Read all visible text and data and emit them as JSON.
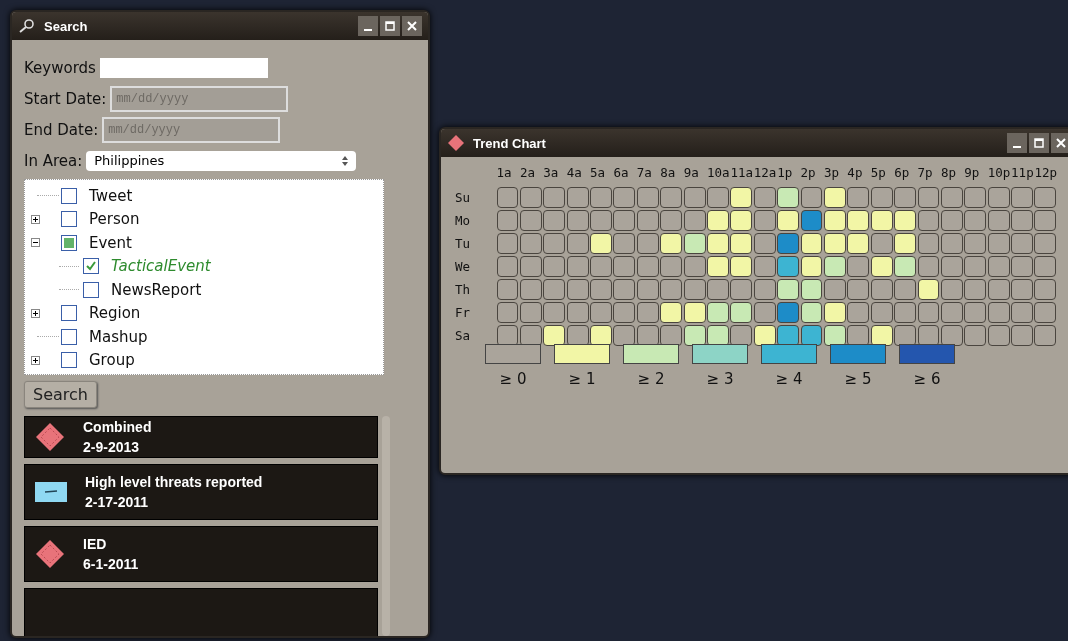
{
  "search_window": {
    "title": "Search",
    "keywords": {
      "label": "Keywords"
    },
    "start_date": {
      "label": "Start Date:",
      "placeholder": "mm/dd/yyyy"
    },
    "end_date": {
      "label": "End Date:",
      "placeholder": "mm/dd/yyyy"
    },
    "area": {
      "label": "In Area:",
      "value": "Philippines"
    },
    "tree": [
      {
        "label": "Tweet",
        "checked": false,
        "indeterminate": false,
        "selected": false
      },
      {
        "label": "Person",
        "checked": false,
        "indeterminate": false,
        "selected": false,
        "expanded": false
      },
      {
        "label": "Event",
        "checked": false,
        "indeterminate": true,
        "selected": false,
        "expanded": true,
        "children": [
          {
            "label": "TacticalEvent",
            "checked": true,
            "selected": true
          },
          {
            "label": "NewsReport",
            "checked": false,
            "indeterminate": false,
            "selected": false
          }
        ]
      },
      {
        "label": "Region",
        "checked": false,
        "indeterminate": false,
        "selected": false,
        "expanded": false
      },
      {
        "label": "Mashup",
        "checked": false,
        "indeterminate": false,
        "selected": false
      },
      {
        "label": "Group",
        "checked": false,
        "indeterminate": false,
        "selected": false,
        "expanded": false
      }
    ],
    "search_button": "Search",
    "results": [
      {
        "kind": "diamond",
        "title": "Combined",
        "date": "2-9-2013"
      },
      {
        "kind": "flag",
        "title": "High level threats reported",
        "date": "2-17-2011"
      },
      {
        "kind": "diamond",
        "title": "IED",
        "date": "6-1-2011"
      },
      {
        "kind": "empty"
      }
    ]
  },
  "trend_window": {
    "title": "Trend Chart",
    "hours": [
      "1a",
      "2a",
      "3a",
      "4a",
      "5a",
      "6a",
      "7a",
      "8a",
      "9a",
      "10a",
      "11a",
      "12a",
      "1p",
      "2p",
      "3p",
      "4p",
      "5p",
      "6p",
      "7p",
      "8p",
      "9p",
      "10p",
      "11p",
      "12p"
    ],
    "days": [
      {
        "label": "Su",
        "cells": [
          {
            "color": "#aaa49b"
          },
          {
            "color": "#aaa49b"
          },
          {
            "color": "#aaa49b"
          },
          {
            "color": "#aaa49b"
          },
          {
            "color": "#aaa49b"
          },
          {
            "color": "#aaa49b"
          },
          {
            "color": "#aaa49b"
          },
          {
            "color": "#aaa49b"
          },
          {
            "color": "#aaa49b"
          },
          {
            "color": "#aaa49b"
          },
          {
            "color": "#f2f6a6"
          },
          {
            "color": "#aaa49b"
          },
          {
            "color": "#c8e9b4"
          },
          {
            "color": "#aaa49b"
          },
          {
            "color": "#f2f6a6"
          },
          {
            "color": "#aaa49b"
          },
          {
            "color": "#aaa49b"
          },
          {
            "color": "#aaa49b"
          },
          {
            "color": "#aaa49b"
          },
          {
            "color": "#aaa49b"
          },
          {
            "color": "#aaa49b"
          },
          {
            "color": "#aaa49b"
          },
          {
            "color": "#aaa49b"
          },
          {
            "color": "#aaa49b"
          }
        ]
      },
      {
        "label": "Mo",
        "cells": [
          {
            "color": "#aaa49b"
          },
          {
            "color": "#aaa49b"
          },
          {
            "color": "#aaa49b"
          },
          {
            "color": "#aaa49b"
          },
          {
            "color": "#aaa49b"
          },
          {
            "color": "#aaa49b"
          },
          {
            "color": "#aaa49b"
          },
          {
            "color": "#aaa49b"
          },
          {
            "color": "#aaa49b"
          },
          {
            "color": "#f2f6a6"
          },
          {
            "color": "#f2f6a6"
          },
          {
            "color": "#aaa49b"
          },
          {
            "color": "#f2f6a6"
          },
          {
            "color": "#1d8cc8"
          },
          {
            "color": "#f2f6a6"
          },
          {
            "color": "#f2f6a6"
          },
          {
            "color": "#f2f6a6"
          },
          {
            "color": "#f2f6a6"
          },
          {
            "color": "#aaa49b"
          },
          {
            "color": "#aaa49b"
          },
          {
            "color": "#aaa49b"
          },
          {
            "color": "#aaa49b"
          },
          {
            "color": "#aaa49b"
          },
          {
            "color": "#aaa49b"
          }
        ]
      },
      {
        "label": "Tu",
        "cells": [
          {
            "color": "#aaa49b"
          },
          {
            "color": "#aaa49b"
          },
          {
            "color": "#aaa49b"
          },
          {
            "color": "#aaa49b"
          },
          {
            "color": "#f2f6a6"
          },
          {
            "color": "#aaa49b"
          },
          {
            "color": "#aaa49b"
          },
          {
            "color": "#f2f6a6"
          },
          {
            "color": "#c8e9b4"
          },
          {
            "color": "#f2f6a6"
          },
          {
            "color": "#f2f6a6"
          },
          {
            "color": "#aaa49b"
          },
          {
            "color": "#1d8cc8"
          },
          {
            "color": "#f2f6a6"
          },
          {
            "color": "#f2f6a6"
          },
          {
            "color": "#f2f6a6"
          },
          {
            "color": "#aaa49b"
          },
          {
            "color": "#f2f6a6"
          },
          {
            "color": "#aaa49b"
          },
          {
            "color": "#aaa49b"
          },
          {
            "color": "#aaa49b"
          },
          {
            "color": "#aaa49b"
          },
          {
            "color": "#aaa49b"
          },
          {
            "color": "#aaa49b"
          }
        ]
      },
      {
        "label": "We",
        "cells": [
          {
            "color": "#aaa49b"
          },
          {
            "color": "#aaa49b"
          },
          {
            "color": "#aaa49b"
          },
          {
            "color": "#aaa49b"
          },
          {
            "color": "#aaa49b"
          },
          {
            "color": "#aaa49b"
          },
          {
            "color": "#aaa49b"
          },
          {
            "color": "#aaa49b"
          },
          {
            "color": "#aaa49b"
          },
          {
            "color": "#f2f6a6"
          },
          {
            "color": "#f2f6a6"
          },
          {
            "color": "#aaa49b"
          },
          {
            "color": "#3db4d2"
          },
          {
            "color": "#f2f6a6"
          },
          {
            "color": "#c8e9b4"
          },
          {
            "color": "#aaa49b"
          },
          {
            "color": "#f2f6a6"
          },
          {
            "color": "#c8e9b4"
          },
          {
            "color": "#aaa49b"
          },
          {
            "color": "#aaa49b"
          },
          {
            "color": "#aaa49b"
          },
          {
            "color": "#aaa49b"
          },
          {
            "color": "#aaa49b"
          },
          {
            "color": "#aaa49b"
          }
        ]
      },
      {
        "label": "Th",
        "cells": [
          {
            "color": "#aaa49b"
          },
          {
            "color": "#aaa49b"
          },
          {
            "color": "#aaa49b"
          },
          {
            "color": "#aaa49b"
          },
          {
            "color": "#aaa49b"
          },
          {
            "color": "#aaa49b"
          },
          {
            "color": "#aaa49b"
          },
          {
            "color": "#aaa49b"
          },
          {
            "color": "#aaa49b"
          },
          {
            "color": "#aaa49b"
          },
          {
            "color": "#aaa49b"
          },
          {
            "color": "#aaa49b"
          },
          {
            "color": "#c8e9b4"
          },
          {
            "color": "#c8e9b4"
          },
          {
            "color": "#aaa49b"
          },
          {
            "color": "#aaa49b"
          },
          {
            "color": "#aaa49b"
          },
          {
            "color": "#aaa49b"
          },
          {
            "color": "#f2f6a6"
          },
          {
            "color": "#aaa49b"
          },
          {
            "color": "#aaa49b"
          },
          {
            "color": "#aaa49b"
          },
          {
            "color": "#aaa49b"
          },
          {
            "color": "#aaa49b"
          }
        ]
      },
      {
        "label": "Fr",
        "cells": [
          {
            "color": "#aaa49b"
          },
          {
            "color": "#aaa49b"
          },
          {
            "color": "#aaa49b"
          },
          {
            "color": "#aaa49b"
          },
          {
            "color": "#aaa49b"
          },
          {
            "color": "#aaa49b"
          },
          {
            "color": "#aaa49b"
          },
          {
            "color": "#f2f6a6"
          },
          {
            "color": "#f2f6a6"
          },
          {
            "color": "#c8e9b4"
          },
          {
            "color": "#c8e9b4"
          },
          {
            "color": "#aaa49b"
          },
          {
            "color": "#1d8cc8"
          },
          {
            "color": "#c8e9b4"
          },
          {
            "color": "#f2f6a6"
          },
          {
            "color": "#aaa49b"
          },
          {
            "color": "#aaa49b"
          },
          {
            "color": "#aaa49b"
          },
          {
            "color": "#aaa49b"
          },
          {
            "color": "#aaa49b"
          },
          {
            "color": "#aaa49b"
          },
          {
            "color": "#aaa49b"
          },
          {
            "color": "#aaa49b"
          },
          {
            "color": "#aaa49b"
          }
        ]
      },
      {
        "label": "Sa",
        "cells": [
          {
            "color": "#aaa49b"
          },
          {
            "color": "#aaa49b"
          },
          {
            "color": "#f2f6a6"
          },
          {
            "color": "#aaa49b"
          },
          {
            "color": "#f2f6a6"
          },
          {
            "color": "#aaa49b"
          },
          {
            "color": "#aaa49b"
          },
          {
            "color": "#aaa49b"
          },
          {
            "color": "#c8e9b4"
          },
          {
            "color": "#c8e9b4"
          },
          {
            "color": "#aaa49b"
          },
          {
            "color": "#f2f6a6"
          },
          {
            "color": "#3db4d2"
          },
          {
            "color": "#3db4d2"
          },
          {
            "color": "#c8e9b4"
          },
          {
            "color": "#aaa49b"
          },
          {
            "color": "#f2f6a6"
          },
          {
            "color": "#aaa49b"
          },
          {
            "color": "#aaa49b"
          },
          {
            "color": "#aaa49b"
          },
          {
            "color": "#aaa49b"
          },
          {
            "color": "#aaa49b"
          },
          {
            "color": "#aaa49b"
          },
          {
            "color": "#aaa49b"
          }
        ]
      }
    ],
    "legend": [
      {
        "label": "≥ 0",
        "color": "#aaa49b"
      },
      {
        "label": "≥ 1",
        "color": "#f2f6a6"
      },
      {
        "label": "≥ 2",
        "color": "#c8e9b4"
      },
      {
        "label": "≥ 3",
        "color": "#8dd4c6"
      },
      {
        "label": "≥ 4",
        "color": "#3db4d2"
      },
      {
        "label": "≥ 5",
        "color": "#1d8cc8"
      },
      {
        "label": "≥ 6",
        "color": "#2456ae"
      }
    ]
  }
}
